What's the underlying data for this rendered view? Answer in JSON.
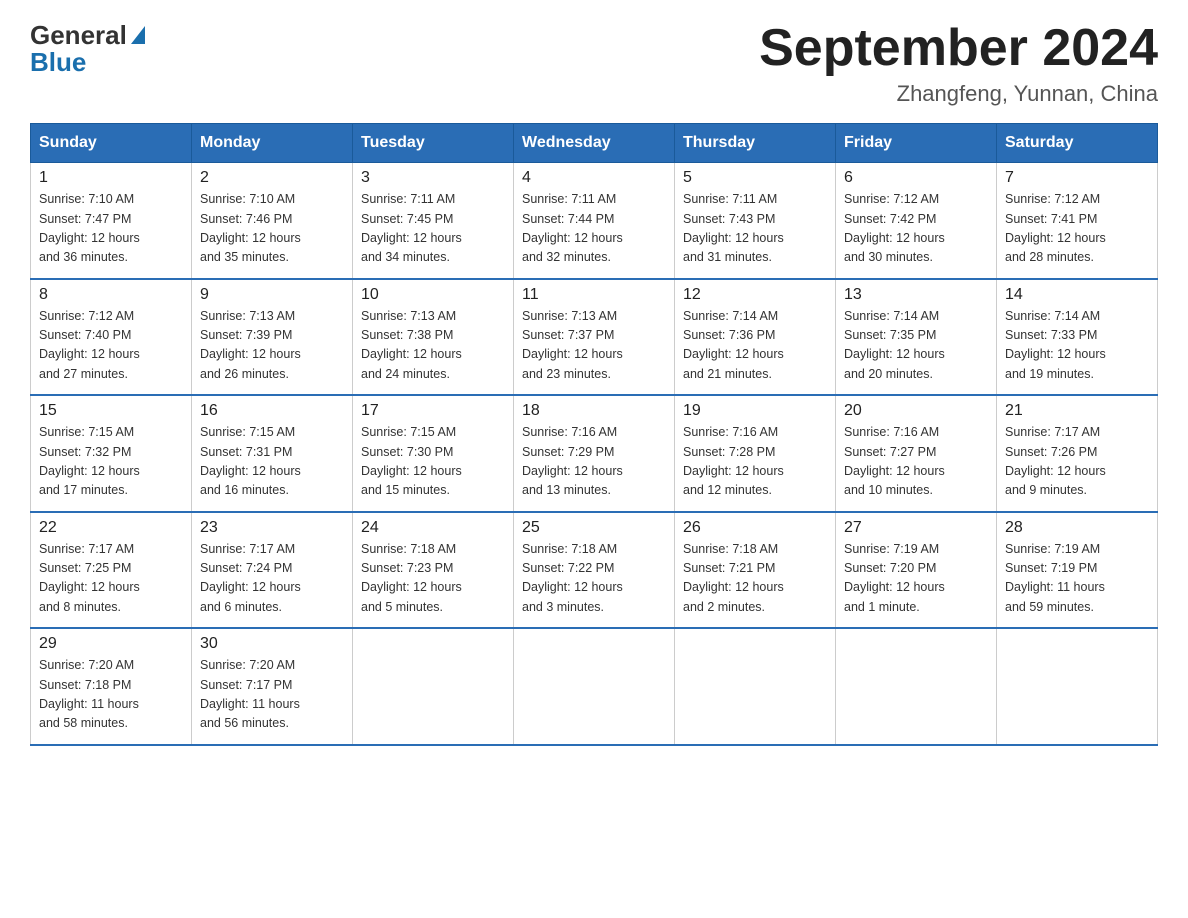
{
  "logo": {
    "general": "General",
    "blue": "Blue"
  },
  "header": {
    "title": "September 2024",
    "subtitle": "Zhangfeng, Yunnan, China"
  },
  "weekdays": [
    "Sunday",
    "Monday",
    "Tuesday",
    "Wednesday",
    "Thursday",
    "Friday",
    "Saturday"
  ],
  "weeks": [
    [
      {
        "day": "1",
        "sunrise": "7:10 AM",
        "sunset": "7:47 PM",
        "daylight": "12 hours and 36 minutes."
      },
      {
        "day": "2",
        "sunrise": "7:10 AM",
        "sunset": "7:46 PM",
        "daylight": "12 hours and 35 minutes."
      },
      {
        "day": "3",
        "sunrise": "7:11 AM",
        "sunset": "7:45 PM",
        "daylight": "12 hours and 34 minutes."
      },
      {
        "day": "4",
        "sunrise": "7:11 AM",
        "sunset": "7:44 PM",
        "daylight": "12 hours and 32 minutes."
      },
      {
        "day": "5",
        "sunrise": "7:11 AM",
        "sunset": "7:43 PM",
        "daylight": "12 hours and 31 minutes."
      },
      {
        "day": "6",
        "sunrise": "7:12 AM",
        "sunset": "7:42 PM",
        "daylight": "12 hours and 30 minutes."
      },
      {
        "day": "7",
        "sunrise": "7:12 AM",
        "sunset": "7:41 PM",
        "daylight": "12 hours and 28 minutes."
      }
    ],
    [
      {
        "day": "8",
        "sunrise": "7:12 AM",
        "sunset": "7:40 PM",
        "daylight": "12 hours and 27 minutes."
      },
      {
        "day": "9",
        "sunrise": "7:13 AM",
        "sunset": "7:39 PM",
        "daylight": "12 hours and 26 minutes."
      },
      {
        "day": "10",
        "sunrise": "7:13 AM",
        "sunset": "7:38 PM",
        "daylight": "12 hours and 24 minutes."
      },
      {
        "day": "11",
        "sunrise": "7:13 AM",
        "sunset": "7:37 PM",
        "daylight": "12 hours and 23 minutes."
      },
      {
        "day": "12",
        "sunrise": "7:14 AM",
        "sunset": "7:36 PM",
        "daylight": "12 hours and 21 minutes."
      },
      {
        "day": "13",
        "sunrise": "7:14 AM",
        "sunset": "7:35 PM",
        "daylight": "12 hours and 20 minutes."
      },
      {
        "day": "14",
        "sunrise": "7:14 AM",
        "sunset": "7:33 PM",
        "daylight": "12 hours and 19 minutes."
      }
    ],
    [
      {
        "day": "15",
        "sunrise": "7:15 AM",
        "sunset": "7:32 PM",
        "daylight": "12 hours and 17 minutes."
      },
      {
        "day": "16",
        "sunrise": "7:15 AM",
        "sunset": "7:31 PM",
        "daylight": "12 hours and 16 minutes."
      },
      {
        "day": "17",
        "sunrise": "7:15 AM",
        "sunset": "7:30 PM",
        "daylight": "12 hours and 15 minutes."
      },
      {
        "day": "18",
        "sunrise": "7:16 AM",
        "sunset": "7:29 PM",
        "daylight": "12 hours and 13 minutes."
      },
      {
        "day": "19",
        "sunrise": "7:16 AM",
        "sunset": "7:28 PM",
        "daylight": "12 hours and 12 minutes."
      },
      {
        "day": "20",
        "sunrise": "7:16 AM",
        "sunset": "7:27 PM",
        "daylight": "12 hours and 10 minutes."
      },
      {
        "day": "21",
        "sunrise": "7:17 AM",
        "sunset": "7:26 PM",
        "daylight": "12 hours and 9 minutes."
      }
    ],
    [
      {
        "day": "22",
        "sunrise": "7:17 AM",
        "sunset": "7:25 PM",
        "daylight": "12 hours and 8 minutes."
      },
      {
        "day": "23",
        "sunrise": "7:17 AM",
        "sunset": "7:24 PM",
        "daylight": "12 hours and 6 minutes."
      },
      {
        "day": "24",
        "sunrise": "7:18 AM",
        "sunset": "7:23 PM",
        "daylight": "12 hours and 5 minutes."
      },
      {
        "day": "25",
        "sunrise": "7:18 AM",
        "sunset": "7:22 PM",
        "daylight": "12 hours and 3 minutes."
      },
      {
        "day": "26",
        "sunrise": "7:18 AM",
        "sunset": "7:21 PM",
        "daylight": "12 hours and 2 minutes."
      },
      {
        "day": "27",
        "sunrise": "7:19 AM",
        "sunset": "7:20 PM",
        "daylight": "12 hours and 1 minute."
      },
      {
        "day": "28",
        "sunrise": "7:19 AM",
        "sunset": "7:19 PM",
        "daylight": "11 hours and 59 minutes."
      }
    ],
    [
      {
        "day": "29",
        "sunrise": "7:20 AM",
        "sunset": "7:18 PM",
        "daylight": "11 hours and 58 minutes."
      },
      {
        "day": "30",
        "sunrise": "7:20 AM",
        "sunset": "7:17 PM",
        "daylight": "11 hours and 56 minutes."
      },
      null,
      null,
      null,
      null,
      null
    ]
  ],
  "labels": {
    "sunrise": "Sunrise:",
    "sunset": "Sunset:",
    "daylight": "Daylight:"
  }
}
